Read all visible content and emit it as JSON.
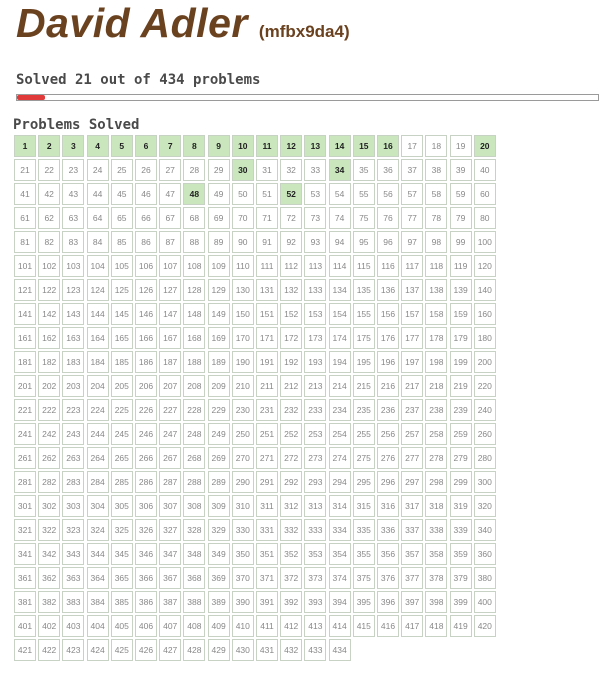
{
  "user": {
    "name": "David Adler",
    "handle": "(mfbx9da4)"
  },
  "progress": {
    "solved": 21,
    "total": 434,
    "text": "Solved 21 out of 434 problems",
    "fill_color": "#e03a3a"
  },
  "section_title": "Problems Solved",
  "problems": {
    "count": 434,
    "per_row": 20,
    "solved_ids": [
      1,
      2,
      3,
      4,
      5,
      6,
      7,
      8,
      9,
      10,
      11,
      12,
      13,
      14,
      15,
      16,
      20,
      30,
      34,
      48,
      52
    ],
    "solved_color": "#c9e6bd"
  }
}
